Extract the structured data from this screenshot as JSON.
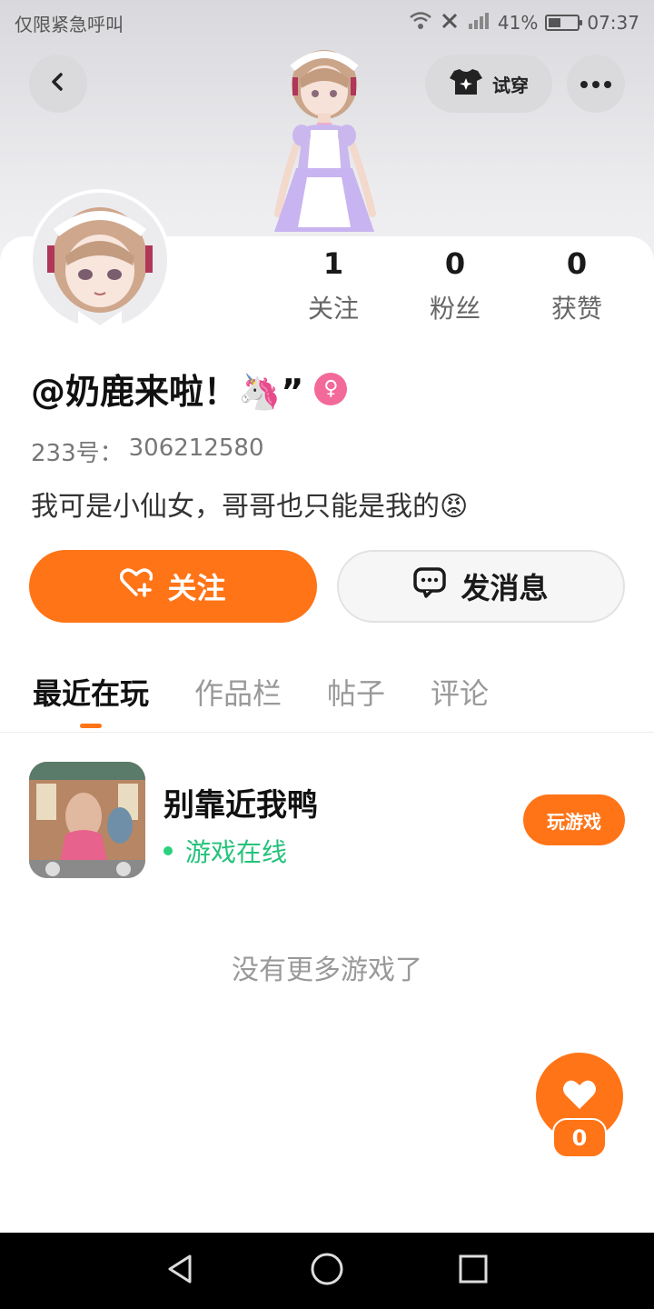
{
  "status_bar": {
    "carrier_text": "仅限紧急呼叫",
    "battery_text": "41%",
    "battery_level": 0.41,
    "time": "07:37"
  },
  "header": {
    "tryon_label": "试穿",
    "icons": {
      "back": "chevron-left-icon",
      "tryon": "shirt-sparkle-icon",
      "more": "more-dots-icon"
    }
  },
  "profile": {
    "username": "@奶鹿来啦！🦄”",
    "gender_symbol": "♀",
    "id_label": "233号：",
    "id_value": "306212580",
    "bio": "我可是小仙女，哥哥也只能是我的😡",
    "stats": [
      {
        "value": "1",
        "label": "关注"
      },
      {
        "value": "0",
        "label": "粉丝"
      },
      {
        "value": "0",
        "label": "获赞"
      }
    ]
  },
  "actions": {
    "follow_label": "关注",
    "message_label": "发消息"
  },
  "tabs": [
    {
      "label": "最近在玩",
      "active": true
    },
    {
      "label": "作品栏",
      "active": false
    },
    {
      "label": "帖子",
      "active": false
    },
    {
      "label": "评论",
      "active": false
    }
  ],
  "games": [
    {
      "title": "别靠近我鸭",
      "status": "游戏在线",
      "play_label": "玩游戏"
    }
  ],
  "empty_text": "没有更多游戏了",
  "fab": {
    "count": "0"
  },
  "colors": {
    "accent": "#ff7417",
    "online": "#26c27b",
    "female": "#f2699a"
  }
}
